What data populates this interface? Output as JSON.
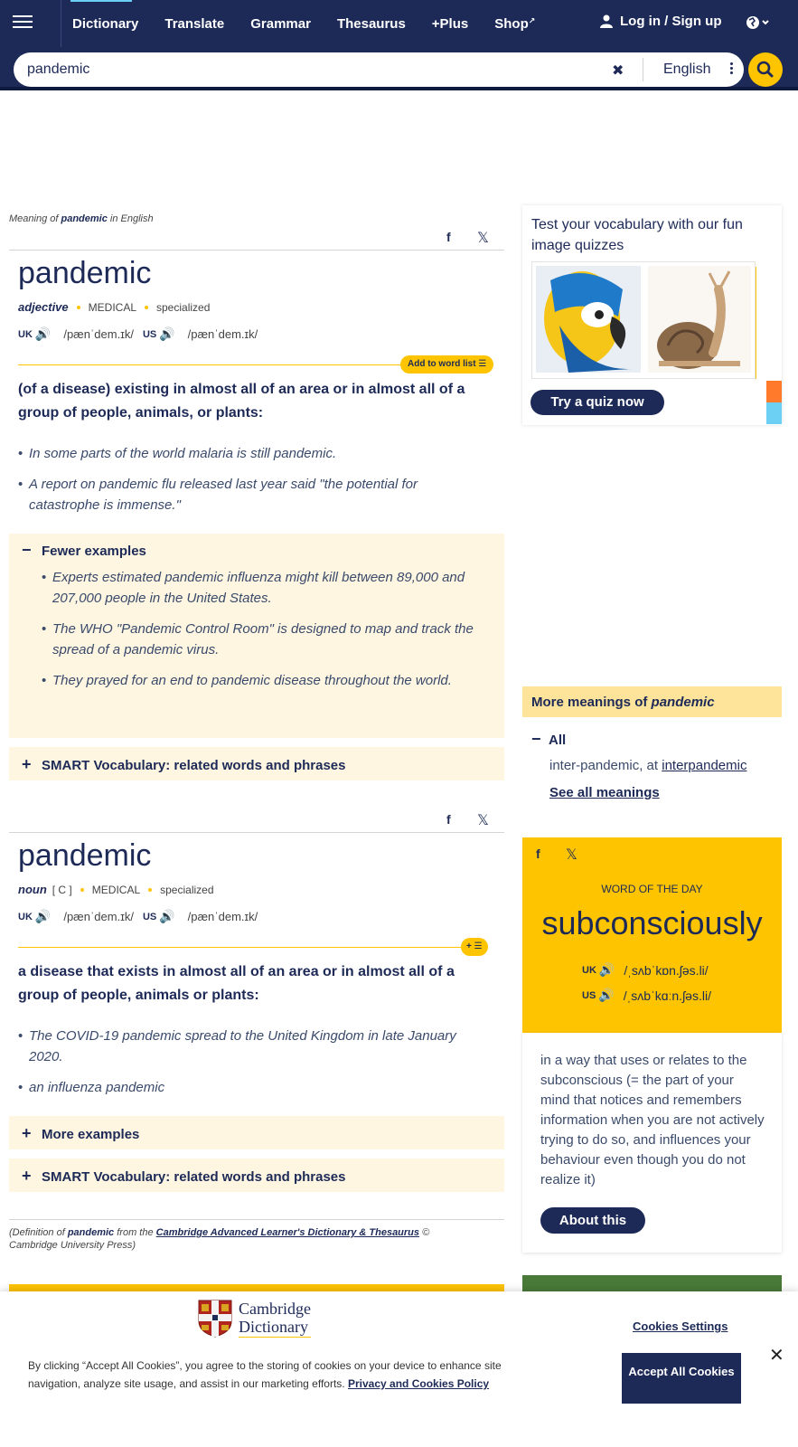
{
  "header": {
    "nav": [
      {
        "label": "Dictionary",
        "active": true
      },
      {
        "label": "Translate"
      },
      {
        "label": "Grammar"
      },
      {
        "label": "Thesaurus"
      },
      {
        "label": "+Plus"
      },
      {
        "label": "Shop"
      }
    ],
    "login_label": "Log in / Sign up",
    "icons": [
      "menu-icon",
      "user-icon",
      "globe-icon",
      "external-link-icon",
      "search-icon",
      "clear-icon",
      "more-vertical-icon"
    ]
  },
  "search": {
    "value": "pandemic",
    "language": "English"
  },
  "breadcrumb": {
    "prefix": "Meaning of",
    "word": "pandemic",
    "suffix": "in English"
  },
  "entries": [
    {
      "headword": "pandemic",
      "pos": "adjective",
      "gram": "",
      "labels": [
        "MEDICAL",
        "specialized"
      ],
      "uk_label": "UK",
      "uk_ipa": "/pænˈdem.ɪk/",
      "us_label": "US",
      "us_ipa": "/pænˈdem.ɪk/",
      "add_label": "Add to word list",
      "definition": "(of a disease) existing in almost all of an area or in almost all of a group of people, animals, or plants:",
      "examples": [
        "In some parts of the world malaria is still pandemic.",
        "A report on pandemic flu released last year said \"the potential for catastrophe is immense.\""
      ],
      "panel_title": "Fewer examples",
      "panel_examples": [
        "Experts estimated pandemic influenza might kill between 89,000 and 207,000 people in the United States.",
        "The WHO \"Pandemic Control Room\" is designed to map and track the spread of a pandemic virus.",
        "They prayed for an end to pandemic disease throughout the world."
      ],
      "smart_vocab": "SMART Vocabulary: related words and phrases"
    },
    {
      "headword": "pandemic",
      "pos": "noun",
      "gram": "[ C ]",
      "labels": [
        "MEDICAL",
        "specialized"
      ],
      "uk_label": "UK",
      "uk_ipa": "/pænˈdem.ɪk/",
      "us_label": "US",
      "us_ipa": "/pænˈdem.ɪk/",
      "definition": "a disease that exists in almost all of an area or in almost all of a group of people, animals or plants:",
      "examples": [
        "The COVID-19 pandemic spread to the United Kingdom in late January 2020.",
        "an influenza pandemic"
      ],
      "more_examples": "More examples",
      "smart_vocab": "SMART Vocabulary: related words and phrases"
    }
  ],
  "source_note": {
    "prefix": "(Definition of",
    "word": "pandemic",
    "from": "from the",
    "dictionary": "Cambridge Advanced Learner's Dictionary & Thesaurus",
    "suffix": "© Cambridge University Press)"
  },
  "quiz": {
    "title": "Test your vocabulary with our fun image quizzes",
    "button": "Try a quiz now"
  },
  "more_meanings": {
    "title_prefix": "More meanings of",
    "word": "pandemic",
    "all_label": "All",
    "line_prefix": "inter-pandemic, at",
    "line_link": "interpandemic",
    "see_all": "See all meanings"
  },
  "word_of_day": {
    "label": "WORD OF THE DAY",
    "word": "subconsciously",
    "uk_label": "UK",
    "uk_ipa": "/ˌsʌbˈkɒn.ʃəs.li/",
    "us_label": "US",
    "us_ipa": "/ˌsʌbˈkɑːn.ʃəs.li/",
    "definition": "in a way that uses or relates to the subconscious (= the part of your mind that notices and remembers information when you are not actively trying to do so, and influences your behaviour even though you do not realize it)",
    "about": "About this"
  },
  "cookie": {
    "brand_line1": "Cambridge",
    "brand_line2": "Dictionary",
    "settings": "Cookies Settings",
    "text": "By clicking “Accept All Cookies”, you agree to the storing of cookies on your device to enhance site navigation, analyze site usage, and assist in our marketing efforts.",
    "policy_link": "Privacy and Cookies Policy",
    "accept": "Accept All Cookies"
  },
  "colors": {
    "navy": "#1d2a57",
    "yellow": "#fec400",
    "cream": "#fef6e1",
    "cyan": "#6cd0f5"
  }
}
